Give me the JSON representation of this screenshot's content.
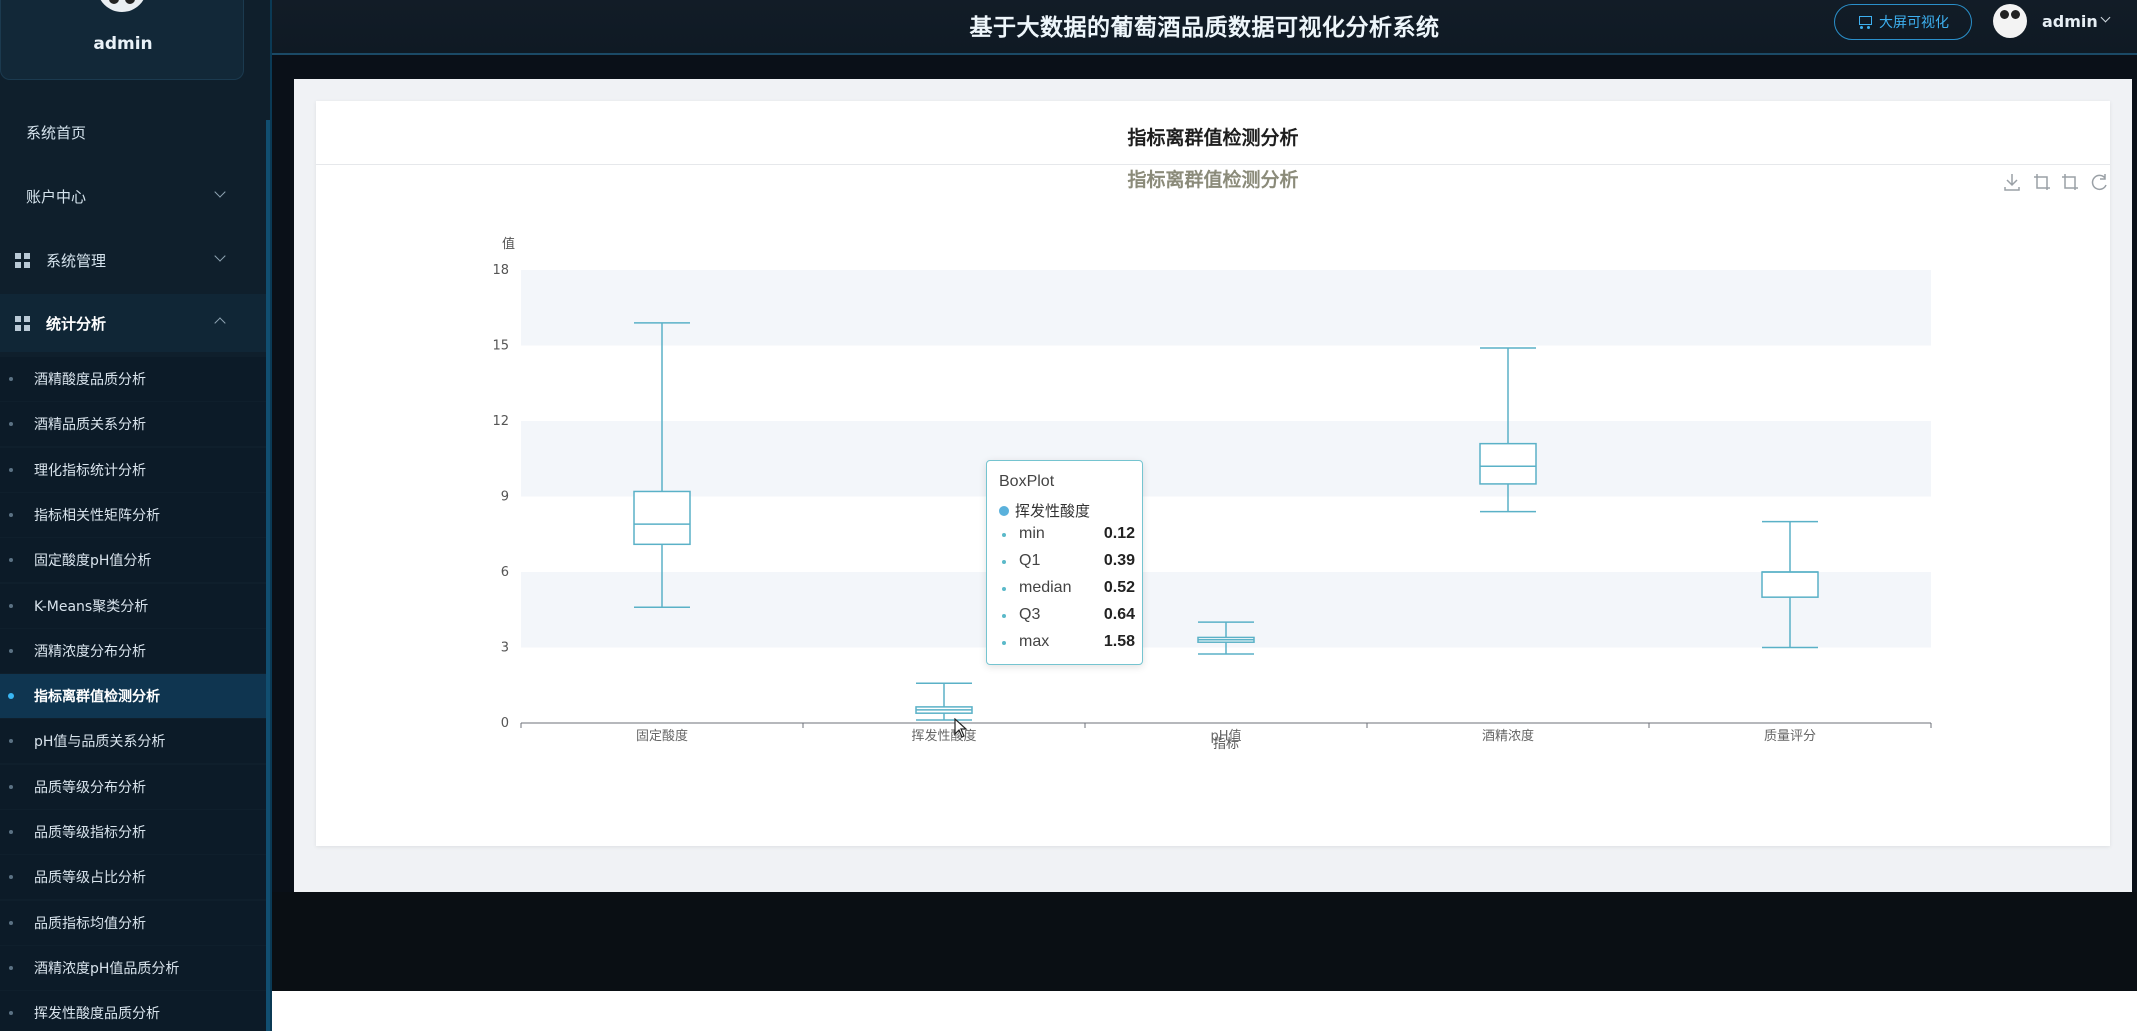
{
  "user": {
    "name": "admin"
  },
  "header": {
    "title": "基于大数据的葡萄酒品质数据可视化分析系统",
    "screen_button": "大屏可视化",
    "username": "admin"
  },
  "menu": [
    {
      "label": "系统首页"
    },
    {
      "label": "账户中心"
    },
    {
      "label": "系统管理"
    },
    {
      "label": "统计分析"
    }
  ],
  "submenu": [
    {
      "label": "酒精酸度品质分析"
    },
    {
      "label": "酒精品质关系分析"
    },
    {
      "label": "理化指标统计分析"
    },
    {
      "label": "指标相关性矩阵分析"
    },
    {
      "label": "固定酸度pH值分析"
    },
    {
      "label": "K-Means聚类分析"
    },
    {
      "label": "酒精浓度分布分析"
    },
    {
      "label": "指标离群值检测分析"
    },
    {
      "label": "pH值与品质关系分析"
    },
    {
      "label": "品质等级分布分析"
    },
    {
      "label": "品质等级指标分析"
    },
    {
      "label": "品质等级占比分析"
    },
    {
      "label": "品质指标均值分析"
    },
    {
      "label": "酒精浓度pH值品质分析"
    },
    {
      "label": "挥发性酸度品质分析"
    }
  ],
  "panel": {
    "title": "指标离群值检测分析"
  },
  "chart_data": {
    "type": "boxplot",
    "title": "指标离群值检测分析",
    "ylabel": "值",
    "xlabel": "指标",
    "ylim": [
      0,
      18
    ],
    "yticks": [
      0,
      3,
      6,
      9,
      12,
      15,
      18
    ],
    "categories": [
      "固定酸度",
      "挥发性酸度",
      "pH值",
      "酒精浓度",
      "质量评分"
    ],
    "series": [
      {
        "name": "挥发性酸度",
        "values": [
          {
            "min": 4.6,
            "q1": 7.1,
            "median": 7.9,
            "q3": 9.2,
            "max": 15.9
          },
          {
            "min": 0.12,
            "q1": 0.39,
            "median": 0.52,
            "q3": 0.64,
            "max": 1.58
          },
          {
            "min": 2.74,
            "q1": 3.21,
            "median": 3.31,
            "q3": 3.4,
            "max": 4.01
          },
          {
            "min": 8.4,
            "q1": 9.5,
            "median": 10.2,
            "q3": 11.1,
            "max": 14.9
          },
          {
            "min": 3,
            "q1": 5,
            "median": 6,
            "q3": 6,
            "max": 8
          }
        ]
      }
    ],
    "color": "#5ab1c7",
    "grid": "alternating-bands",
    "legend": "none"
  },
  "tooltip": {
    "title": "BoxPlot",
    "series": "挥发性酸度",
    "rows": [
      {
        "k": "min",
        "v": "0.12"
      },
      {
        "k": "Q1",
        "v": "0.39"
      },
      {
        "k": "median",
        "v": "0.52"
      },
      {
        "k": "Q3",
        "v": "0.64"
      },
      {
        "k": "max",
        "v": "1.58"
      }
    ]
  },
  "colors": {
    "accent": "#39b7f4",
    "box": "#5ab1c7",
    "sidebar_bg": "#0f1f2c"
  }
}
